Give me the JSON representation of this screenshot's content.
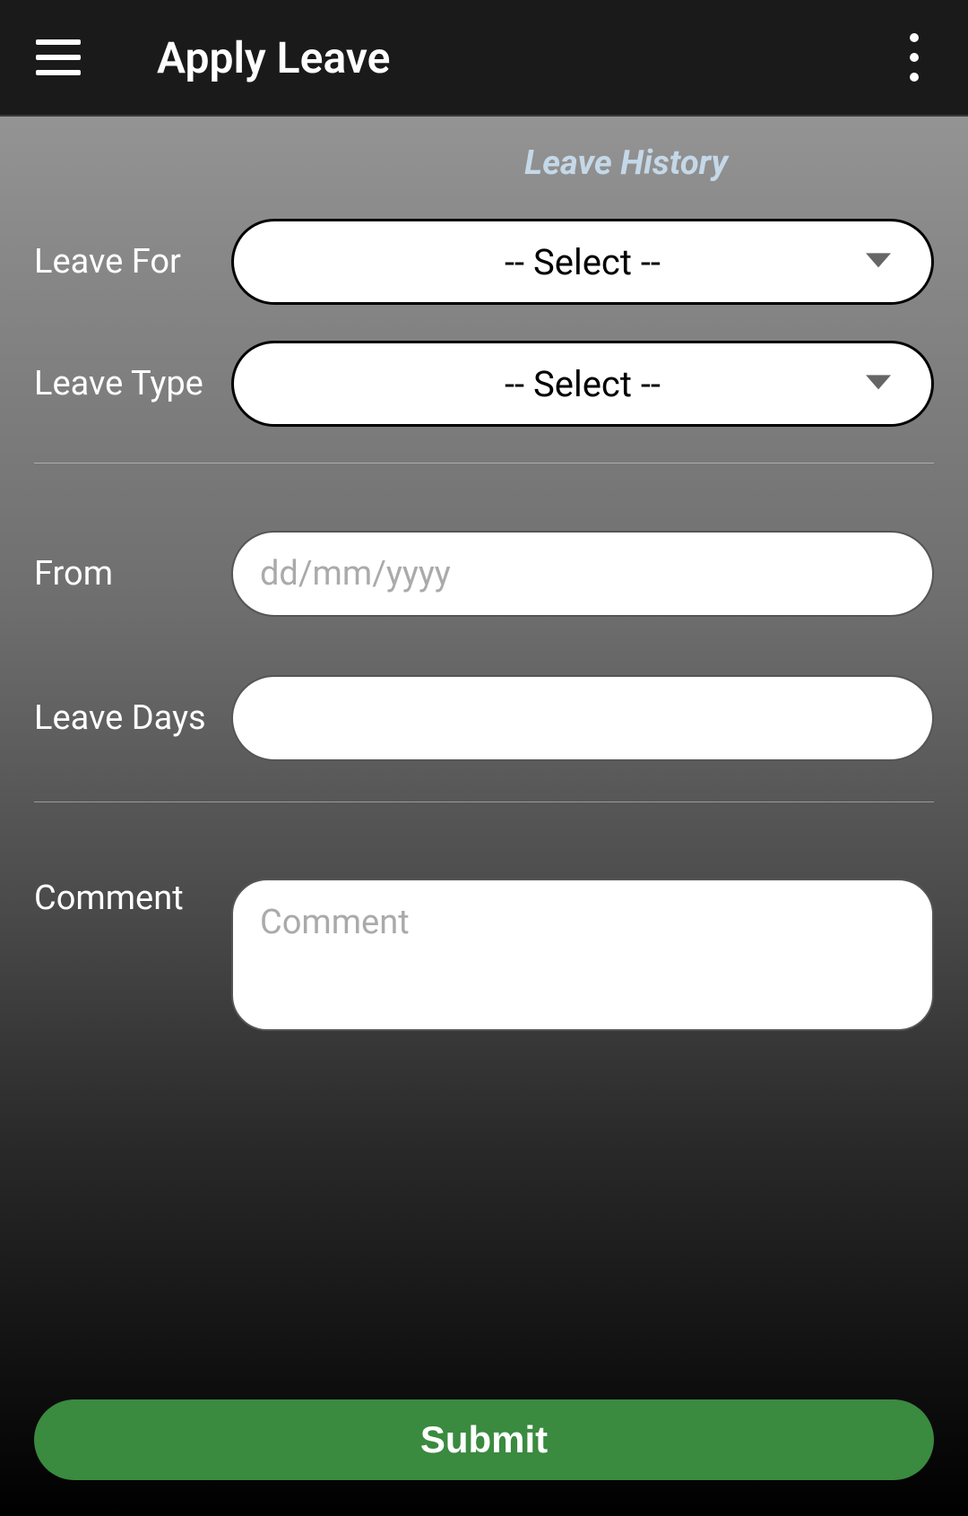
{
  "header": {
    "title": "Apply Leave"
  },
  "links": {
    "history": "Leave History"
  },
  "form": {
    "leave_for": {
      "label": "Leave For",
      "selected": "-- Select --"
    },
    "leave_type": {
      "label": "Leave Type",
      "selected": "-- Select --"
    },
    "from": {
      "label": "From",
      "placeholder": "dd/mm/yyyy",
      "value": ""
    },
    "leave_days": {
      "label": "Leave Days",
      "value": ""
    },
    "comment": {
      "label": "Comment",
      "placeholder": "Comment",
      "value": ""
    }
  },
  "buttons": {
    "submit": "Submit"
  }
}
